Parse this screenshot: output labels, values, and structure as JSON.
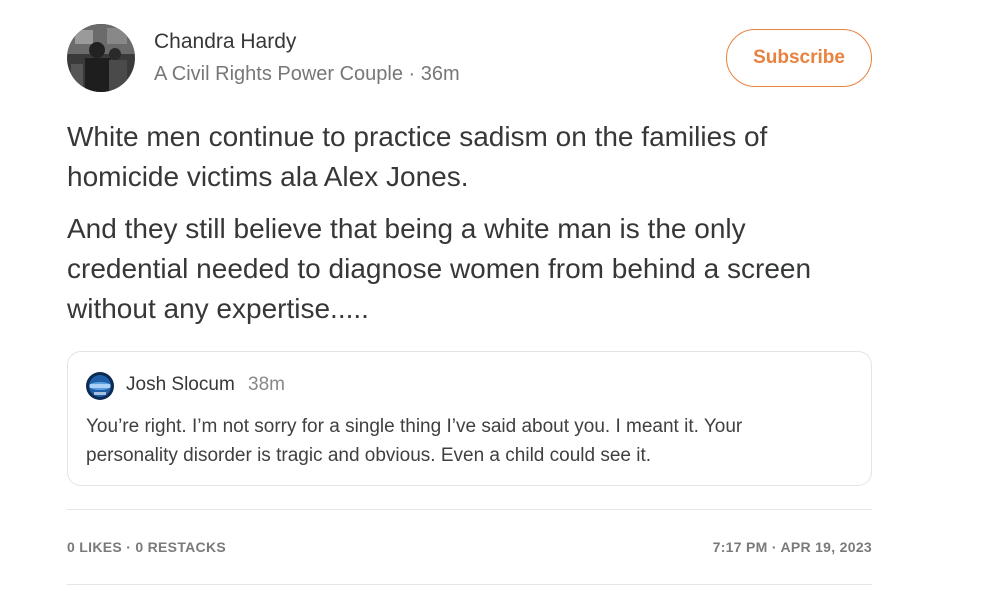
{
  "author": {
    "name": "Chandra Hardy",
    "publication": "A Civil Rights Power Couple",
    "separator": " · ",
    "time": "36m"
  },
  "subscribe_label": "Subscribe",
  "post": {
    "paragraphs": [
      "White men continue to practice sadism on the families of homicide victims ala Alex Jones.",
      "And they still believe that being a white man is the only credential needed to diagnose women from behind a screen without any expertise....."
    ]
  },
  "quote": {
    "author": "Josh Slocum",
    "time": "38m",
    "text": "You’re right. I’m not sorry for a single thing I’ve said about you. I meant it. Your personality disorder is tragic and obvious. Even a child could see it."
  },
  "footer": {
    "likes": "0 LIKES",
    "dot": " · ",
    "restacks": "0 RESTACKS",
    "time": "7:17 PM",
    "date": "APR 19, 2023"
  },
  "colors": {
    "accent": "#e8823f",
    "text": "#363737",
    "muted": "#777777"
  }
}
